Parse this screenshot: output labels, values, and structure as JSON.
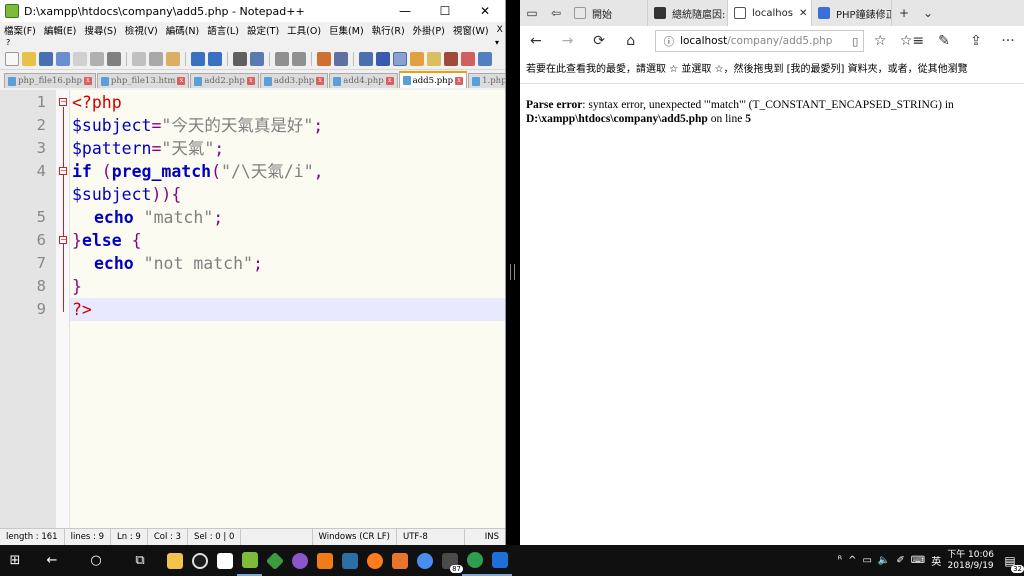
{
  "npp": {
    "title": "D:\\xampp\\htdocs\\company\\add5.php - Notepad++",
    "window_controls": {
      "minimize": "—",
      "maximize": "☐",
      "close": "✕"
    },
    "menu": [
      "檔案(F)",
      "編輯(E)",
      "搜尋(S)",
      "檢視(V)",
      "編碼(N)",
      "語言(L)",
      "設定(T)",
      "工具(O)",
      "巨集(M)",
      "執行(R)",
      "外掛(P)",
      "視窗(W)"
    ],
    "menu_close": "X",
    "menu_help": "?",
    "menu_overflow": "▾",
    "tabs": [
      "php_file16.php",
      "php_file13.htm",
      "add2.php",
      "add3.php",
      "add4.php",
      "add5.php",
      "1.php"
    ],
    "active_tab": "add5.php",
    "tab_close_glyph": "x",
    "line_numbers": [
      "1",
      "2",
      "3",
      "4",
      "",
      "5",
      "6",
      "7",
      "8",
      "9"
    ],
    "code": {
      "l1": "<?php",
      "l2_var": "$subject",
      "l2_eq": "=",
      "l2_str": "\"今天的天氣真是好\"",
      "l2_semi": ";",
      "l3_var": "$pattern",
      "l3_eq": "=",
      "l3_str": "\"天氣\"",
      "l3_semi": ";",
      "l4_if": "if",
      "l4_paren": " (",
      "l4_fn": "preg_match",
      "l4_paren2": "(",
      "l4_str": "\"/\\天氣/i\"",
      "l4_comma": ",",
      "l4b_var": "$subject",
      "l4b_close": ")){",
      "l5_echo": "echo",
      "l5_str": " \"match\"",
      "l5_semi": ";",
      "l6_close": "}",
      "l6_else": "else",
      "l6_open": " {",
      "l7_echo": "echo",
      "l7_str": " \"not match\"",
      "l7_semi": ";",
      "l8": "}",
      "l9": "?>"
    },
    "fold_marker": "−",
    "status": {
      "length": "length : 161",
      "lines": "lines : 9",
      "ln": "Ln : 9",
      "col": "Col : 3",
      "sel": "Sel : 0 | 0",
      "eol": "Windows (CR LF)",
      "encoding": "UTF-8",
      "mode": "INS"
    }
  },
  "splitter": {
    "grip": ""
  },
  "edge": {
    "tab_icons": [
      "▭",
      "⇦"
    ],
    "tabs": [
      {
        "label": "開始",
        "color": "#e8e8e8"
      },
      {
        "label": "總統隨扈因:",
        "color": "#333333"
      },
      {
        "label": "localhos",
        "color": "#ffffff"
      },
      {
        "label": "PHP鐘錶修正",
        "color": "#3a6fd8"
      }
    ],
    "tab_close": "✕",
    "new_tab": "+",
    "tab_menu": "⌄",
    "nav": {
      "back": "←",
      "forward": "→",
      "refresh": "⟳",
      "home": "⌂",
      "reader": "▯",
      "favorite": "☆",
      "favorites": "☆≡",
      "notes": "✎",
      "share": "⇪",
      "more": "···"
    },
    "address": {
      "info": "ⓘ",
      "host": "localhost",
      "path": "/company/add5.php"
    },
    "favbar": "若要在此查看我的最愛，請選取 ☆ 並選取 ☆，然後拖曳到 [我的最愛列] 資料夾，或者，從其他瀏覽",
    "error": {
      "label": "Parse error",
      "message": ": syntax error, unexpected '\"match\"' (T_CONSTANT_ENCAPSED_STRING) in",
      "path": "D:\\xampp\\htdocs\\company\\add5.php",
      "on_line": " on line ",
      "line": "5"
    }
  },
  "taskbar": {
    "start": "⊞",
    "back": "←",
    "search": "○",
    "taskview": "⧉",
    "apps": [
      {
        "name": "file-explorer",
        "color": "#f2c24a"
      },
      {
        "name": "clock-app",
        "color": "#1c1c1c"
      },
      {
        "name": "google",
        "color": "#ffffff"
      },
      {
        "name": "notepad-plus-plus",
        "color": "#7dbb3c"
      },
      {
        "name": "app-diamond",
        "color": "#3d9a3d"
      },
      {
        "name": "app-purple",
        "color": "#8a56c9"
      },
      {
        "name": "xampp",
        "color": "#f07c16"
      },
      {
        "name": "app-monitor",
        "color": "#2c6ea6"
      },
      {
        "name": "firefox",
        "color": "#ff7b1c"
      },
      {
        "name": "app-orange",
        "color": "#e6752d"
      },
      {
        "name": "chrome-alt",
        "color": "#4a8df0"
      },
      {
        "name": "mail",
        "color": "#4a4a4a"
      },
      {
        "name": "chrome",
        "color": "#2e9e4f"
      },
      {
        "name": "edge",
        "color": "#1e6fd8"
      }
    ],
    "mail_badge": "87",
    "tray": {
      "people": "ᴿ",
      "chevron": "^",
      "network": "▭",
      "volume": "🔈",
      "pen": "✐",
      "keyboard": "⌨",
      "lang": "英",
      "time": "下午 10:06",
      "date": "2018/9/19",
      "notif_badge": "32",
      "notif": "▤"
    }
  }
}
